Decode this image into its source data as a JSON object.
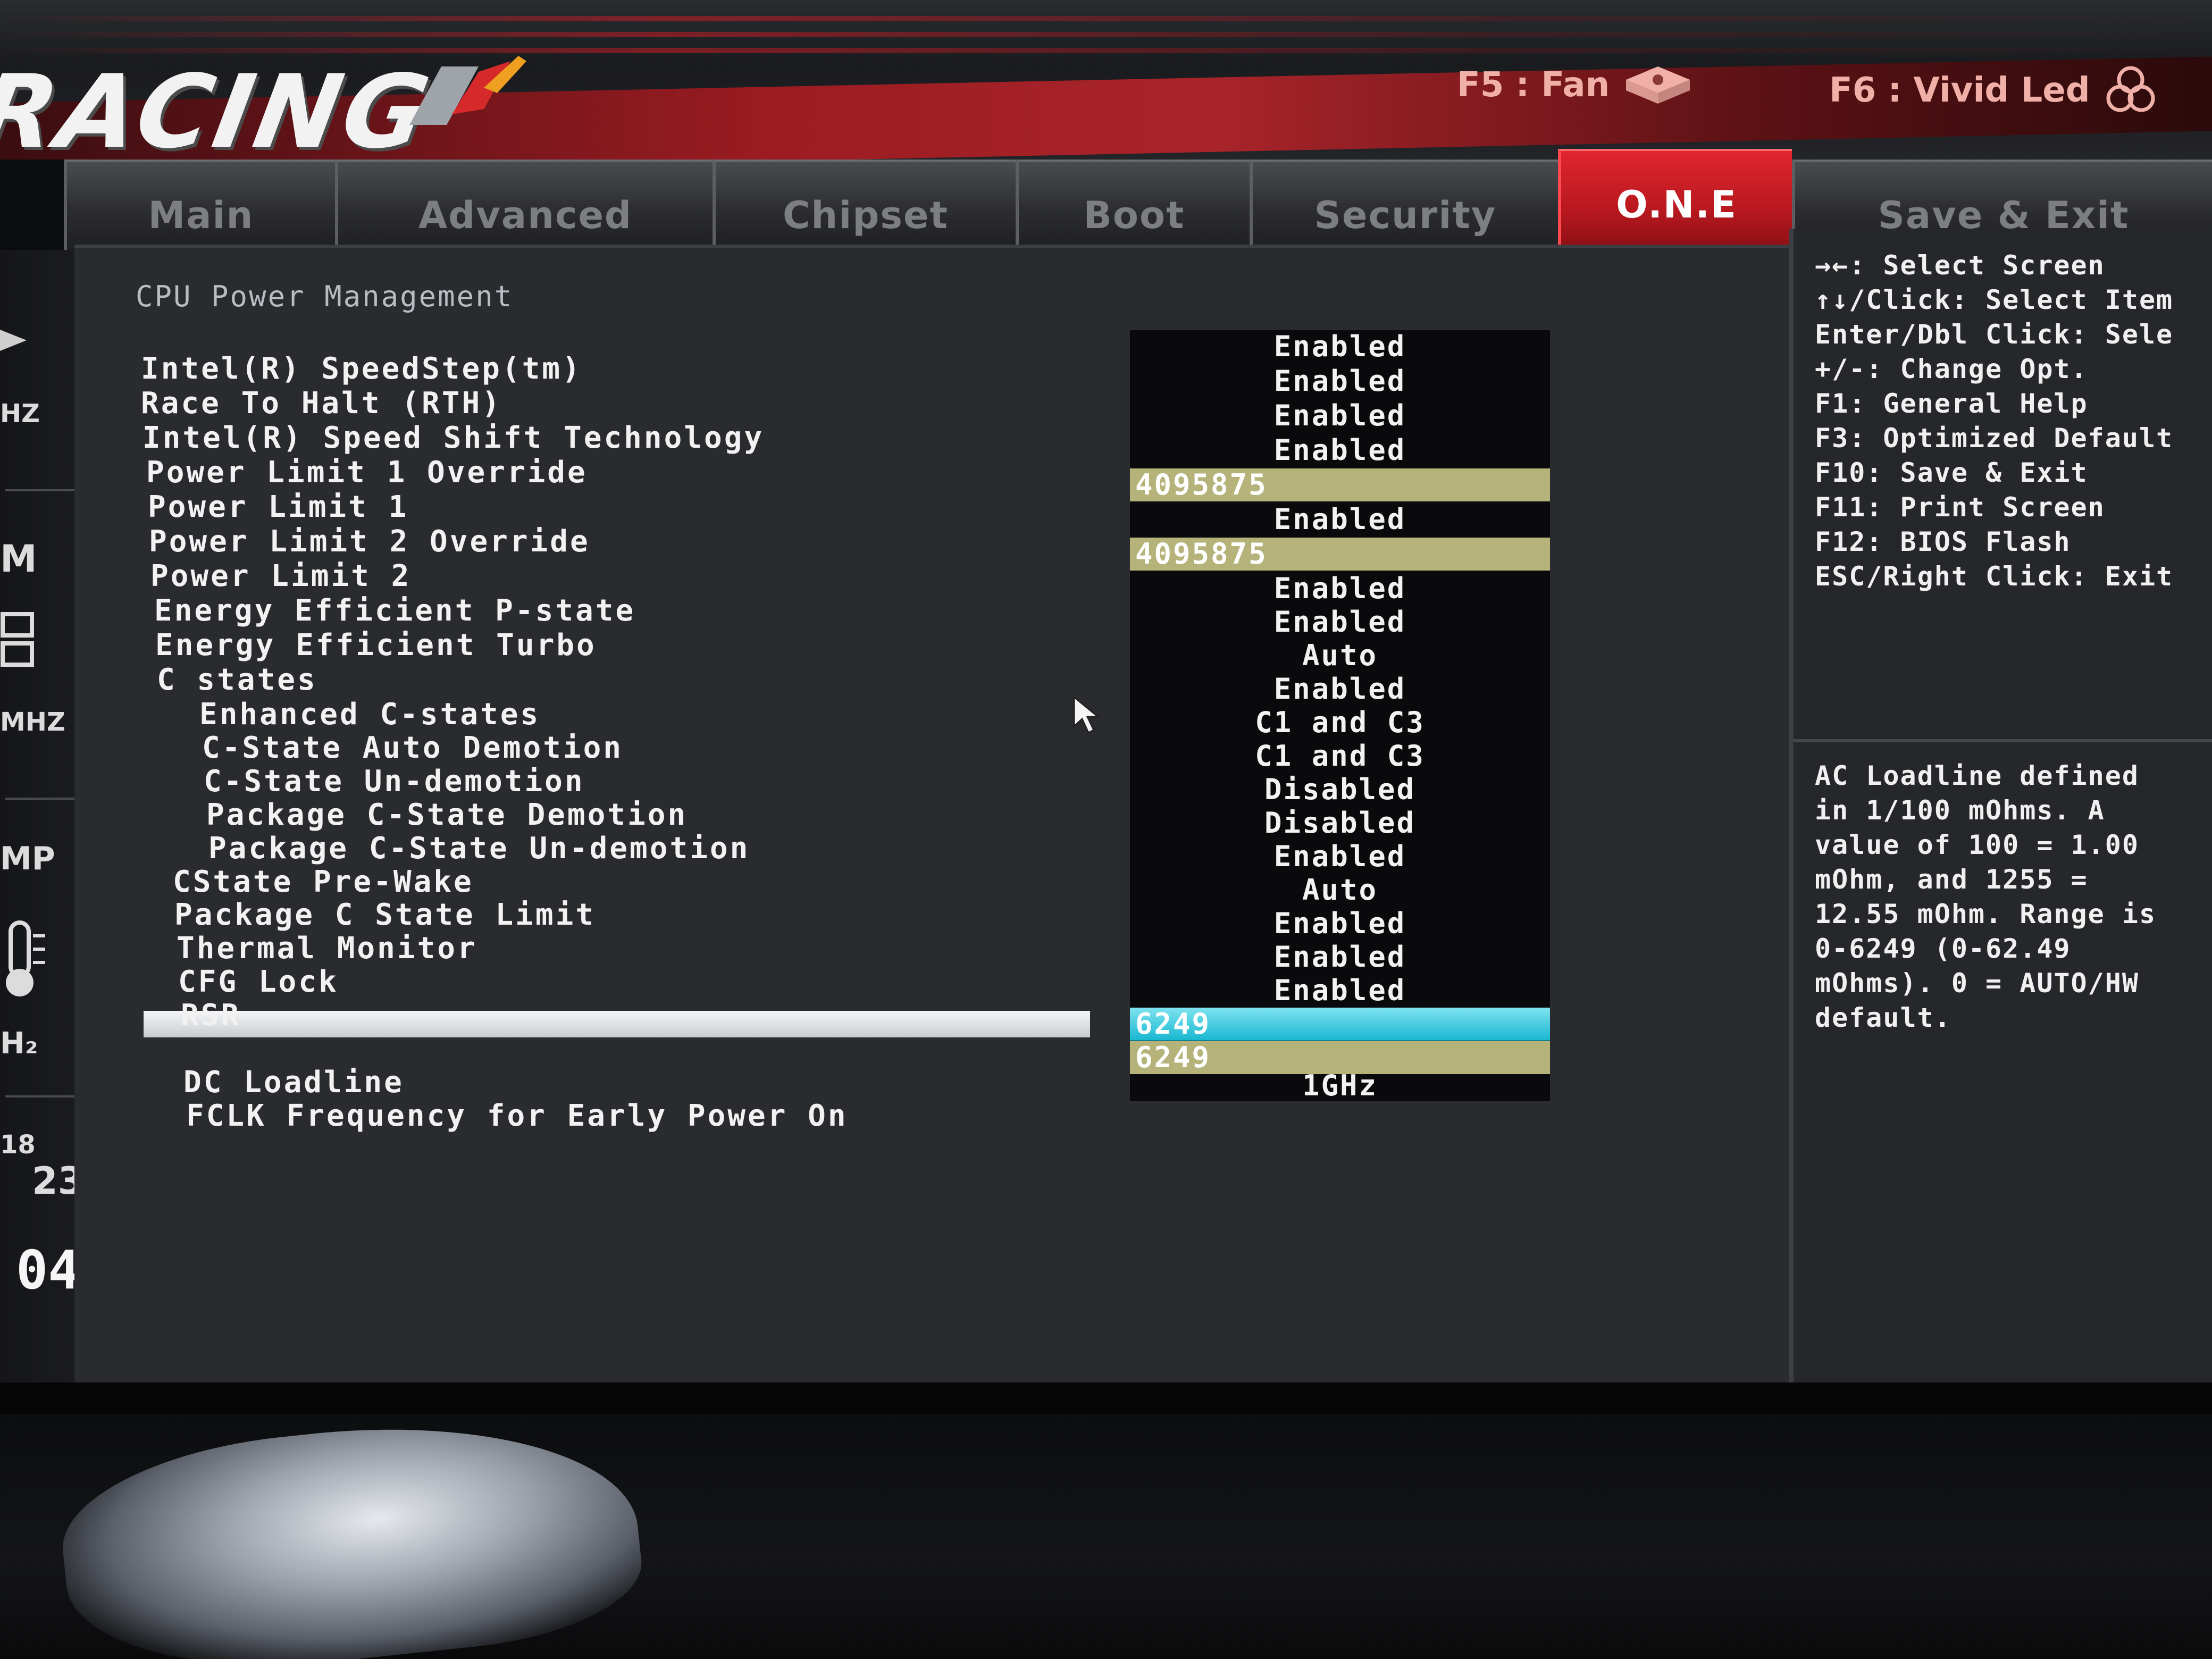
{
  "header": {
    "logo_text": "RACING",
    "hotkeys": [
      {
        "label": "F5 : Fan",
        "icon": "fan-icon"
      },
      {
        "label": "F6 : Vivid Led",
        "icon": "led-icon"
      }
    ]
  },
  "tabs": [
    {
      "label": "Main",
      "active": false
    },
    {
      "label": "Advanced",
      "active": false
    },
    {
      "label": "Chipset",
      "active": false
    },
    {
      "label": "Boot",
      "active": false
    },
    {
      "label": "Security",
      "active": false
    },
    {
      "label": "O.N.E",
      "active": true
    },
    {
      "label": "Save & Exit",
      "active": false
    }
  ],
  "sidebar": {
    "items": [
      "HZ",
      "M",
      "MHZ",
      "MP",
      "H₂",
      "18",
      "23",
      "04"
    ]
  },
  "main": {
    "section_title": "CPU Power Management",
    "settings": [
      {
        "label": "Intel(R) SpeedStep(tm)",
        "value": "Enabled"
      },
      {
        "label": "Race To Halt (RTH)",
        "value": "Enabled"
      },
      {
        "label": "Intel(R) Speed Shift Technology",
        "value": "Enabled"
      },
      {
        "label": "Power Limit 1 Override",
        "value": "Enabled"
      },
      {
        "label": "Power Limit 1",
        "value": "4095875"
      },
      {
        "label": "Power Limit 2 Override",
        "value": "Enabled"
      },
      {
        "label": "Power Limit 2",
        "value": "4095875"
      },
      {
        "label": "Energy Efficient P-state",
        "value": "Enabled"
      },
      {
        "label": "Energy Efficient Turbo",
        "value": "Enabled"
      },
      {
        "label": "C states",
        "value": "Auto"
      },
      {
        "label": "Enhanced C-states",
        "value": "Enabled"
      },
      {
        "label": "C-State Auto Demotion",
        "value": "C1 and C3"
      },
      {
        "label": "C-State Un-demotion",
        "value": "C1 and C3"
      },
      {
        "label": "Package C-State Demotion",
        "value": "Disabled"
      },
      {
        "label": "Package C-State Un-demotion",
        "value": "Disabled"
      },
      {
        "label": "CState Pre-Wake",
        "value": "Enabled"
      },
      {
        "label": "Package C State Limit",
        "value": "Auto"
      },
      {
        "label": "Thermal Monitor",
        "value": "Enabled"
      },
      {
        "label": "CFG Lock",
        "value": "Enabled"
      },
      {
        "label": "RSR",
        "value": "Enabled"
      },
      {
        "label": "",
        "value": "6249"
      },
      {
        "label": "DC Loadline",
        "value": "6249"
      },
      {
        "label": "FCLK Frequency for Early Power On",
        "value": "1GHz"
      }
    ]
  },
  "help": {
    "keys": [
      "→←: Select Screen",
      "↑↓/Click: Select Item",
      "Enter/Dbl Click: Sele",
      "+/-: Change Opt.",
      "F1: General Help",
      "F3: Optimized Default",
      "F10: Save & Exit",
      "F11: Print Screen",
      "F12: BIOS Flash",
      "ESC/Right Click: Exit"
    ],
    "description": [
      "AC Loadline defined",
      "in 1/100 mOhms. A",
      "value of 100 = 1.00",
      "mOhm, and 1255 =",
      "12.55 mOhm. Range is",
      "0-6249 (0-62.49",
      "mOhms). 0 = AUTO/HW",
      "default."
    ]
  },
  "colors": {
    "active_tab": "#c61c23",
    "selected_value": "#17b7d1",
    "numeric_field": "#b6b37a",
    "value_column_bg": "#0a0a0c"
  }
}
